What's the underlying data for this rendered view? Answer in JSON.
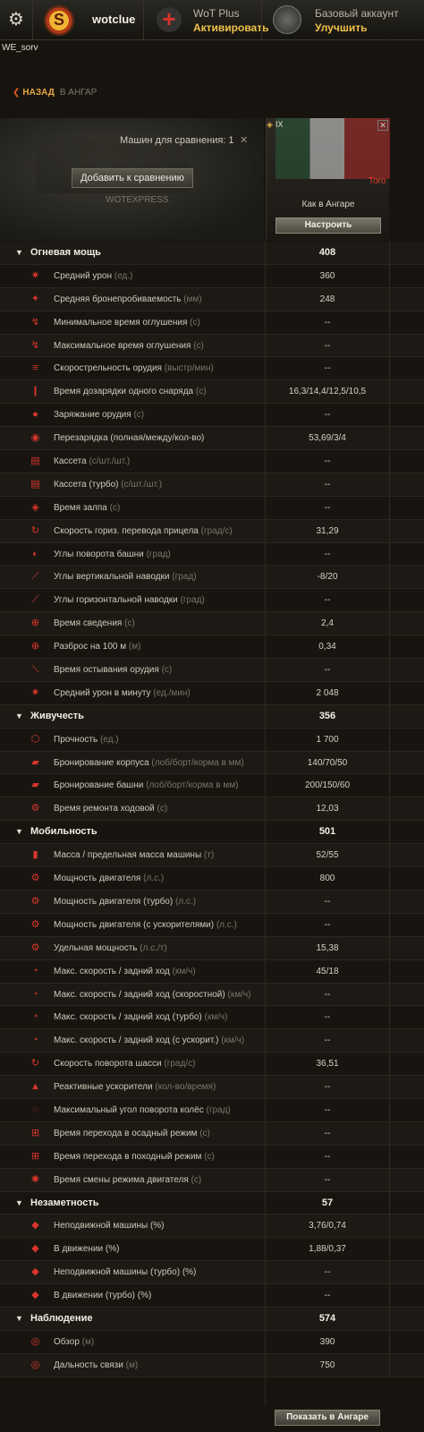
{
  "topbar": {
    "username": "wotclue",
    "wot_plus_title": "WoT Plus",
    "wot_plus_action": "Активировать",
    "account_title": "Базовый аккаунт",
    "account_action": "Улучшить"
  },
  "server": "WE_sorv",
  "nav": {
    "back_label": "НАЗАД",
    "hangar_label": "В АНГАР"
  },
  "compare": {
    "count_label": "Машин для сравнения:",
    "count_value": "1",
    "add_button": "Добавить к сравнению",
    "source": "WOTEXPRESS"
  },
  "vehicle": {
    "tier": "IX",
    "name": "Toro",
    "config_label": "Как в Ангаре",
    "setup_button": "Настроить"
  },
  "footer": {
    "show_button": "Показать в Ангаре"
  },
  "rows": [
    {
      "type": "cat",
      "label": "Огневая мощь",
      "value": "408"
    },
    {
      "type": "stat",
      "icon": "damage-icon",
      "glyph": "✷",
      "label": "Средний урон",
      "unit": "(ед.)",
      "value": "360"
    },
    {
      "type": "stat",
      "icon": "penetration-icon",
      "glyph": "✦",
      "label": "Средняя бронепробиваемость",
      "unit": "(мм)",
      "value": "248"
    },
    {
      "type": "stat",
      "icon": "stun-min-icon",
      "glyph": "↯",
      "label": "Минимальное время оглушения",
      "unit": "(с)",
      "value": "--"
    },
    {
      "type": "stat",
      "icon": "stun-max-icon",
      "glyph": "↯",
      "label": "Максимальное время оглушения",
      "unit": "(с)",
      "value": "--"
    },
    {
      "type": "stat",
      "icon": "rate-of-fire-icon",
      "glyph": "≡",
      "label": "Скорострельность орудия",
      "unit": "(выстр/мин)",
      "value": "--"
    },
    {
      "type": "stat",
      "icon": "shell-reload-icon",
      "glyph": "❙",
      "label": "Время дозарядки одного снаряда",
      "unit": "(с)",
      "value": "16,3/14,4/12,5/10,5"
    },
    {
      "type": "stat",
      "icon": "gun-loading-icon",
      "glyph": "●",
      "label": "Заряжание орудия",
      "unit": "(с)",
      "value": "--"
    },
    {
      "type": "stat",
      "icon": "reload-icon",
      "glyph": "◉",
      "label": "Перезарядка (полная/между/кол-во)",
      "unit": "",
      "value": "53,69/3/4"
    },
    {
      "type": "stat",
      "icon": "clip-icon",
      "glyph": "▤",
      "label": "Кассета",
      "unit": "(с/шт./шт.)",
      "value": "--"
    },
    {
      "type": "stat",
      "icon": "clip-turbo-icon",
      "glyph": "▤",
      "label": "Кассета (турбо)",
      "unit": "(с/шт./шт.)",
      "value": "--"
    },
    {
      "type": "stat",
      "icon": "salvo-icon",
      "glyph": "◈",
      "label": "Время залпа",
      "unit": "(с)",
      "value": "--"
    },
    {
      "type": "stat",
      "icon": "traverse-aim-icon",
      "glyph": "↻",
      "label": "Скорость гориз. перевода прицела",
      "unit": "(град/с)",
      "value": "31,29"
    },
    {
      "type": "stat",
      "icon": "turret-angle-icon",
      "glyph": "◐",
      "label": "Углы поворота башни",
      "unit": "(град)",
      "value": "--"
    },
    {
      "type": "stat",
      "icon": "elevation-icon",
      "glyph": "⟋",
      "label": "Углы вертикальной наводки",
      "unit": "(град)",
      "value": "-8/20"
    },
    {
      "type": "stat",
      "icon": "horizontal-aim-icon",
      "glyph": "⟋",
      "label": "Углы горизонтальной наводки",
      "unit": "(град)",
      "value": "--"
    },
    {
      "type": "stat",
      "icon": "aim-time-icon",
      "glyph": "⊕",
      "label": "Время сведения",
      "unit": "(с)",
      "value": "2,4"
    },
    {
      "type": "stat",
      "icon": "dispersion-icon",
      "glyph": "⊕",
      "label": "Разброс на 100 м",
      "unit": "(м)",
      "value": "0,34"
    },
    {
      "type": "stat",
      "icon": "gun-cooldown-icon",
      "glyph": "⟍",
      "label": "Время остывания орудия",
      "unit": "(с)",
      "value": "--"
    },
    {
      "type": "stat",
      "icon": "dpm-icon",
      "glyph": "✷",
      "label": "Средний урон в минуту",
      "unit": "(ед./мин)",
      "value": "2 048"
    },
    {
      "type": "cat",
      "label": "Живучесть",
      "value": "356"
    },
    {
      "type": "stat",
      "icon": "hitpoints-icon",
      "glyph": "⬡",
      "label": "Прочность",
      "unit": "(ед.)",
      "value": "1 700"
    },
    {
      "type": "stat",
      "icon": "hull-armor-icon",
      "glyph": "▰",
      "label": "Бронирование корпуса",
      "unit": "(лоб/борт/корма в мм)",
      "value": "140/70/50"
    },
    {
      "type": "stat",
      "icon": "turret-armor-icon",
      "glyph": "▰",
      "label": "Бронирование башни",
      "unit": "(лоб/борт/корма в мм)",
      "value": "200/150/60"
    },
    {
      "type": "stat",
      "icon": "repair-icon",
      "glyph": "⚙",
      "label": "Время ремонта ходовой",
      "unit": "(с)",
      "value": "12,03"
    },
    {
      "type": "cat",
      "label": "Мобильность",
      "value": "501"
    },
    {
      "type": "stat",
      "icon": "weight-icon",
      "glyph": "▮",
      "label": "Масса / предельная масса машины",
      "unit": "(т)",
      "value": "52/55"
    },
    {
      "type": "stat",
      "icon": "engine-power-icon",
      "glyph": "⚙",
      "label": "Мощность двигателя",
      "unit": "(л.с.)",
      "value": "800"
    },
    {
      "type": "stat",
      "icon": "engine-turbo-icon",
      "glyph": "⚙",
      "label": "Мощность двигателя (турбо)",
      "unit": "(л.с.)",
      "value": "--"
    },
    {
      "type": "stat",
      "icon": "engine-boost-icon",
      "glyph": "⚙",
      "label": "Мощность двигателя (с ускорителями)",
      "unit": "(л.с.)",
      "value": "--"
    },
    {
      "type": "stat",
      "icon": "specific-power-icon",
      "glyph": "⚙",
      "label": "Удельная мощность",
      "unit": "(л.с./т)",
      "value": "15,38"
    },
    {
      "type": "stat",
      "icon": "speed-icon",
      "glyph": "◔",
      "label": "Макс. скорость / задний ход",
      "unit": "(км/ч)",
      "value": "45/18"
    },
    {
      "type": "stat",
      "icon": "speed-fast-icon",
      "glyph": "◔",
      "label": "Макс. скорость / задний ход (скоростной)",
      "unit": "(км/ч)",
      "value": "--"
    },
    {
      "type": "stat",
      "icon": "speed-turbo-icon",
      "glyph": "◔",
      "label": "Макс. скорость / задний ход (турбо)",
      "unit": "(км/ч)",
      "value": "--"
    },
    {
      "type": "stat",
      "icon": "speed-boost-icon",
      "glyph": "◔",
      "label": "Макс. скорость / задний ход (с ускорит.)",
      "unit": "(км/ч)",
      "value": "--"
    },
    {
      "type": "stat",
      "icon": "hull-traverse-icon",
      "glyph": "↻",
      "label": "Скорость поворота шасси",
      "unit": "(град/с)",
      "value": "36,51"
    },
    {
      "type": "stat",
      "icon": "rocket-booster-icon",
      "glyph": "▲",
      "label": "Реактивные ускорители",
      "unit": "(кол-во/время)",
      "value": "--"
    },
    {
      "type": "stat",
      "icon": "wheel-angle-icon",
      "glyph": "◌",
      "label": "Максимальный угол поворота колёс",
      "unit": "(град)",
      "value": "--"
    },
    {
      "type": "stat",
      "icon": "siege-mode-icon",
      "glyph": "⊞",
      "label": "Время перехода в осадный режим",
      "unit": "(с)",
      "value": "--"
    },
    {
      "type": "stat",
      "icon": "travel-mode-icon",
      "glyph": "⊞",
      "label": "Время перехода в походный режим",
      "unit": "(с)",
      "value": "--"
    },
    {
      "type": "stat",
      "icon": "engine-mode-icon",
      "glyph": "✺",
      "label": "Время смены режима двигателя",
      "unit": "(с)",
      "value": "--"
    },
    {
      "type": "cat",
      "label": "Незаметность",
      "value": "57"
    },
    {
      "type": "stat",
      "icon": "camo-stationary-icon",
      "glyph": "◆",
      "label": "Неподвижной машины (%)",
      "unit": "",
      "value": "3,76/0,74"
    },
    {
      "type": "stat",
      "icon": "camo-moving-icon",
      "glyph": "◆",
      "label": "В движении (%)",
      "unit": "",
      "value": "1,88/0,37"
    },
    {
      "type": "stat",
      "icon": "camo-stationary-turbo-icon",
      "glyph": "◆",
      "label": "Неподвижной машины (турбо) (%)",
      "unit": "",
      "value": "--"
    },
    {
      "type": "stat",
      "icon": "camo-moving-turbo-icon",
      "glyph": "◆",
      "label": "В движении (турбо) (%)",
      "unit": "",
      "value": "--"
    },
    {
      "type": "cat",
      "label": "Наблюдение",
      "value": "574"
    },
    {
      "type": "stat",
      "icon": "view-range-icon",
      "glyph": "◎",
      "label": "Обзор",
      "unit": "(м)",
      "value": "390"
    },
    {
      "type": "stat",
      "icon": "radio-range-icon",
      "glyph": "◎",
      "label": "Дальность связи",
      "unit": "(м)",
      "value": "750"
    }
  ]
}
